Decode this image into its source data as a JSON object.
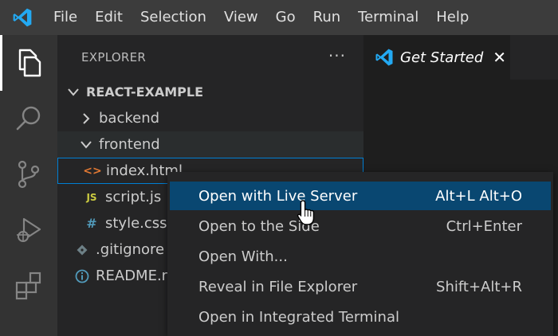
{
  "menu": [
    "File",
    "Edit",
    "Selection",
    "View",
    "Go",
    "Run",
    "Terminal",
    "Help"
  ],
  "activity": [
    {
      "name": "explorer-icon",
      "active": true
    },
    {
      "name": "search-icon",
      "active": false
    },
    {
      "name": "source-control-icon",
      "active": false
    },
    {
      "name": "run-debug-icon",
      "active": false
    },
    {
      "name": "extensions-icon",
      "active": false
    }
  ],
  "sidebar": {
    "title": "EXPLORER",
    "more": "···",
    "tree": [
      {
        "label": "REACT-EXAMPLE",
        "kind": "root",
        "expanded": true
      },
      {
        "label": "backend",
        "kind": "folder",
        "expanded": false
      },
      {
        "label": "frontend",
        "kind": "folder",
        "expanded": true
      },
      {
        "label": "index.html",
        "kind": "file",
        "icon": "<>",
        "icon_color": "#e37933"
      },
      {
        "label": "script.js",
        "kind": "file",
        "icon": "JS",
        "icon_color": "#cbcb41"
      },
      {
        "label": "style.css",
        "kind": "file",
        "icon": "#",
        "icon_color": "#519aba"
      },
      {
        "label": ".gitignore",
        "kind": "file",
        "icon": "git",
        "icon_color": "#6d8086"
      },
      {
        "label": "README.md",
        "kind": "file",
        "icon": "i",
        "icon_color": "#519aba"
      }
    ]
  },
  "tab": {
    "label": "Get Started",
    "close": "✕"
  },
  "context_menu": [
    {
      "label": "Open with Live Server",
      "key": "Alt+L Alt+O",
      "active": true
    },
    {
      "label": "Open to the Side",
      "key": "Ctrl+Enter",
      "active": false
    },
    {
      "label": "Open With...",
      "key": "",
      "active": false
    },
    {
      "label": "Reveal in File Explorer",
      "key": "Shift+Alt+R",
      "active": false
    },
    {
      "label": "Open in Integrated Terminal",
      "key": "",
      "active": false
    }
  ],
  "colors": {
    "accent": "#007acc",
    "menu_highlight": "#094771",
    "selection_border": "#007fd4"
  }
}
